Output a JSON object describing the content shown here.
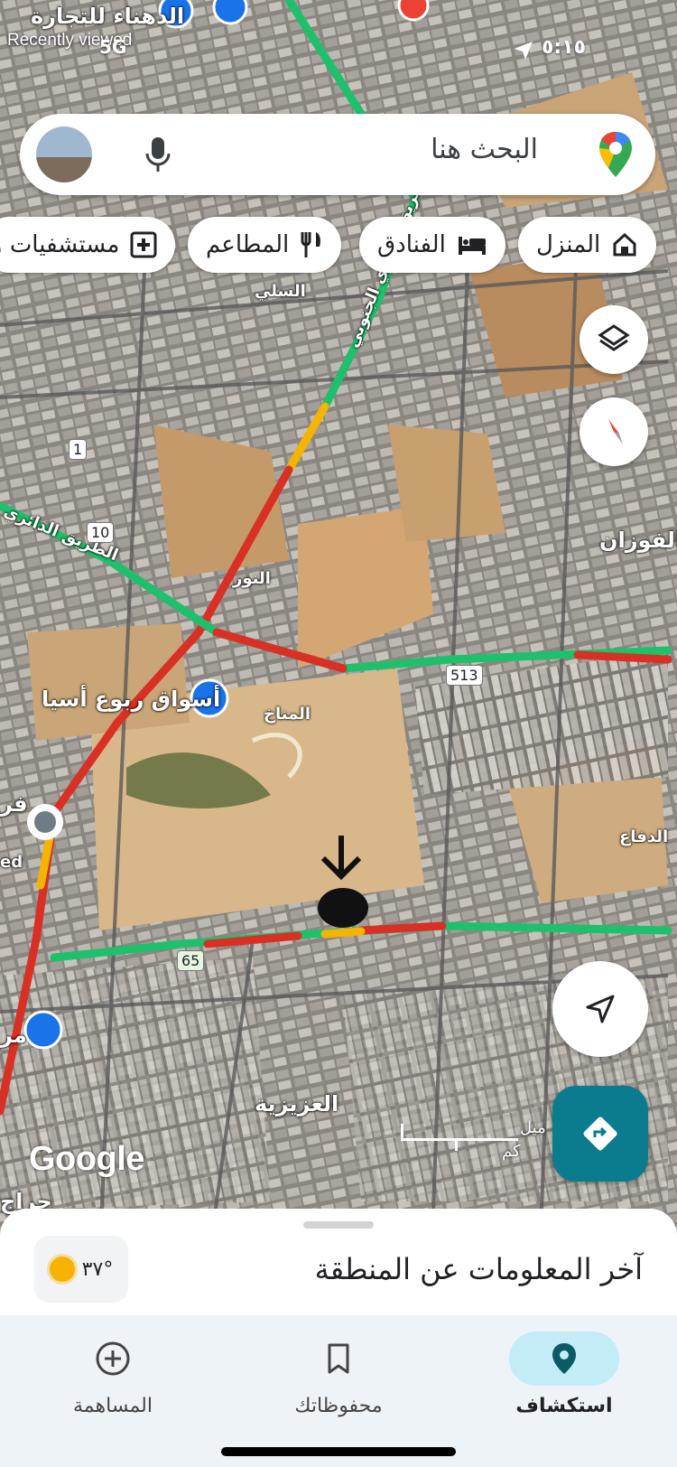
{
  "status": {
    "time": "٥:١٥",
    "network": "5G",
    "recently_viewed": "Recently viewed"
  },
  "search": {
    "placeholder": "البحث هنا"
  },
  "chips": [
    {
      "label": "المنزل",
      "icon": "home-icon"
    },
    {
      "label": "الفنادق",
      "icon": "bed-icon"
    },
    {
      "label": "المطاعم",
      "icon": "restaurant-icon"
    },
    {
      "label": "مستشفيات و",
      "icon": "hospital-icon"
    }
  ],
  "map_labels": {
    "top_left": "الدهناء للتجارة",
    "ring_road_south": "الطريق الدائري الجنوبي",
    "ring_road": "الطريق الدائري",
    "asia_market": "أسواق ربوع أسيا",
    "alfawzan": "ي الفوزان",
    "alsali": "السلي",
    "alnoor": "النور",
    "almanakh": "المناخ",
    "aldifa": "الدفاع",
    "alaziziyah": "العزيزية",
    "road_513": "513",
    "road_65": "65",
    "road_1": "1",
    "road_10": "10",
    "edge_frag1": "فر",
    "edge_frag2": "ed",
    "edge_frag3": "مر",
    "edge_frag4": "حراج"
  },
  "scale": {
    "miles": "ميل",
    "km": "كم"
  },
  "google_logo": "Google",
  "sheet": {
    "title": "آخر المعلومات عن المنطقة",
    "weather": "٣٧°"
  },
  "nav": [
    {
      "label": "استكشاف",
      "icon": "explore-pin-icon",
      "active": true
    },
    {
      "label": "محفوظاتك",
      "icon": "bookmark-icon",
      "active": false
    },
    {
      "label": "المساهمة",
      "icon": "add-circle-icon",
      "active": false
    }
  ],
  "colors": {
    "traffic_green": "#1ec06b",
    "traffic_red": "#d93025",
    "traffic_yellow": "#f4b400",
    "accent_teal": "#0b7c8d"
  }
}
